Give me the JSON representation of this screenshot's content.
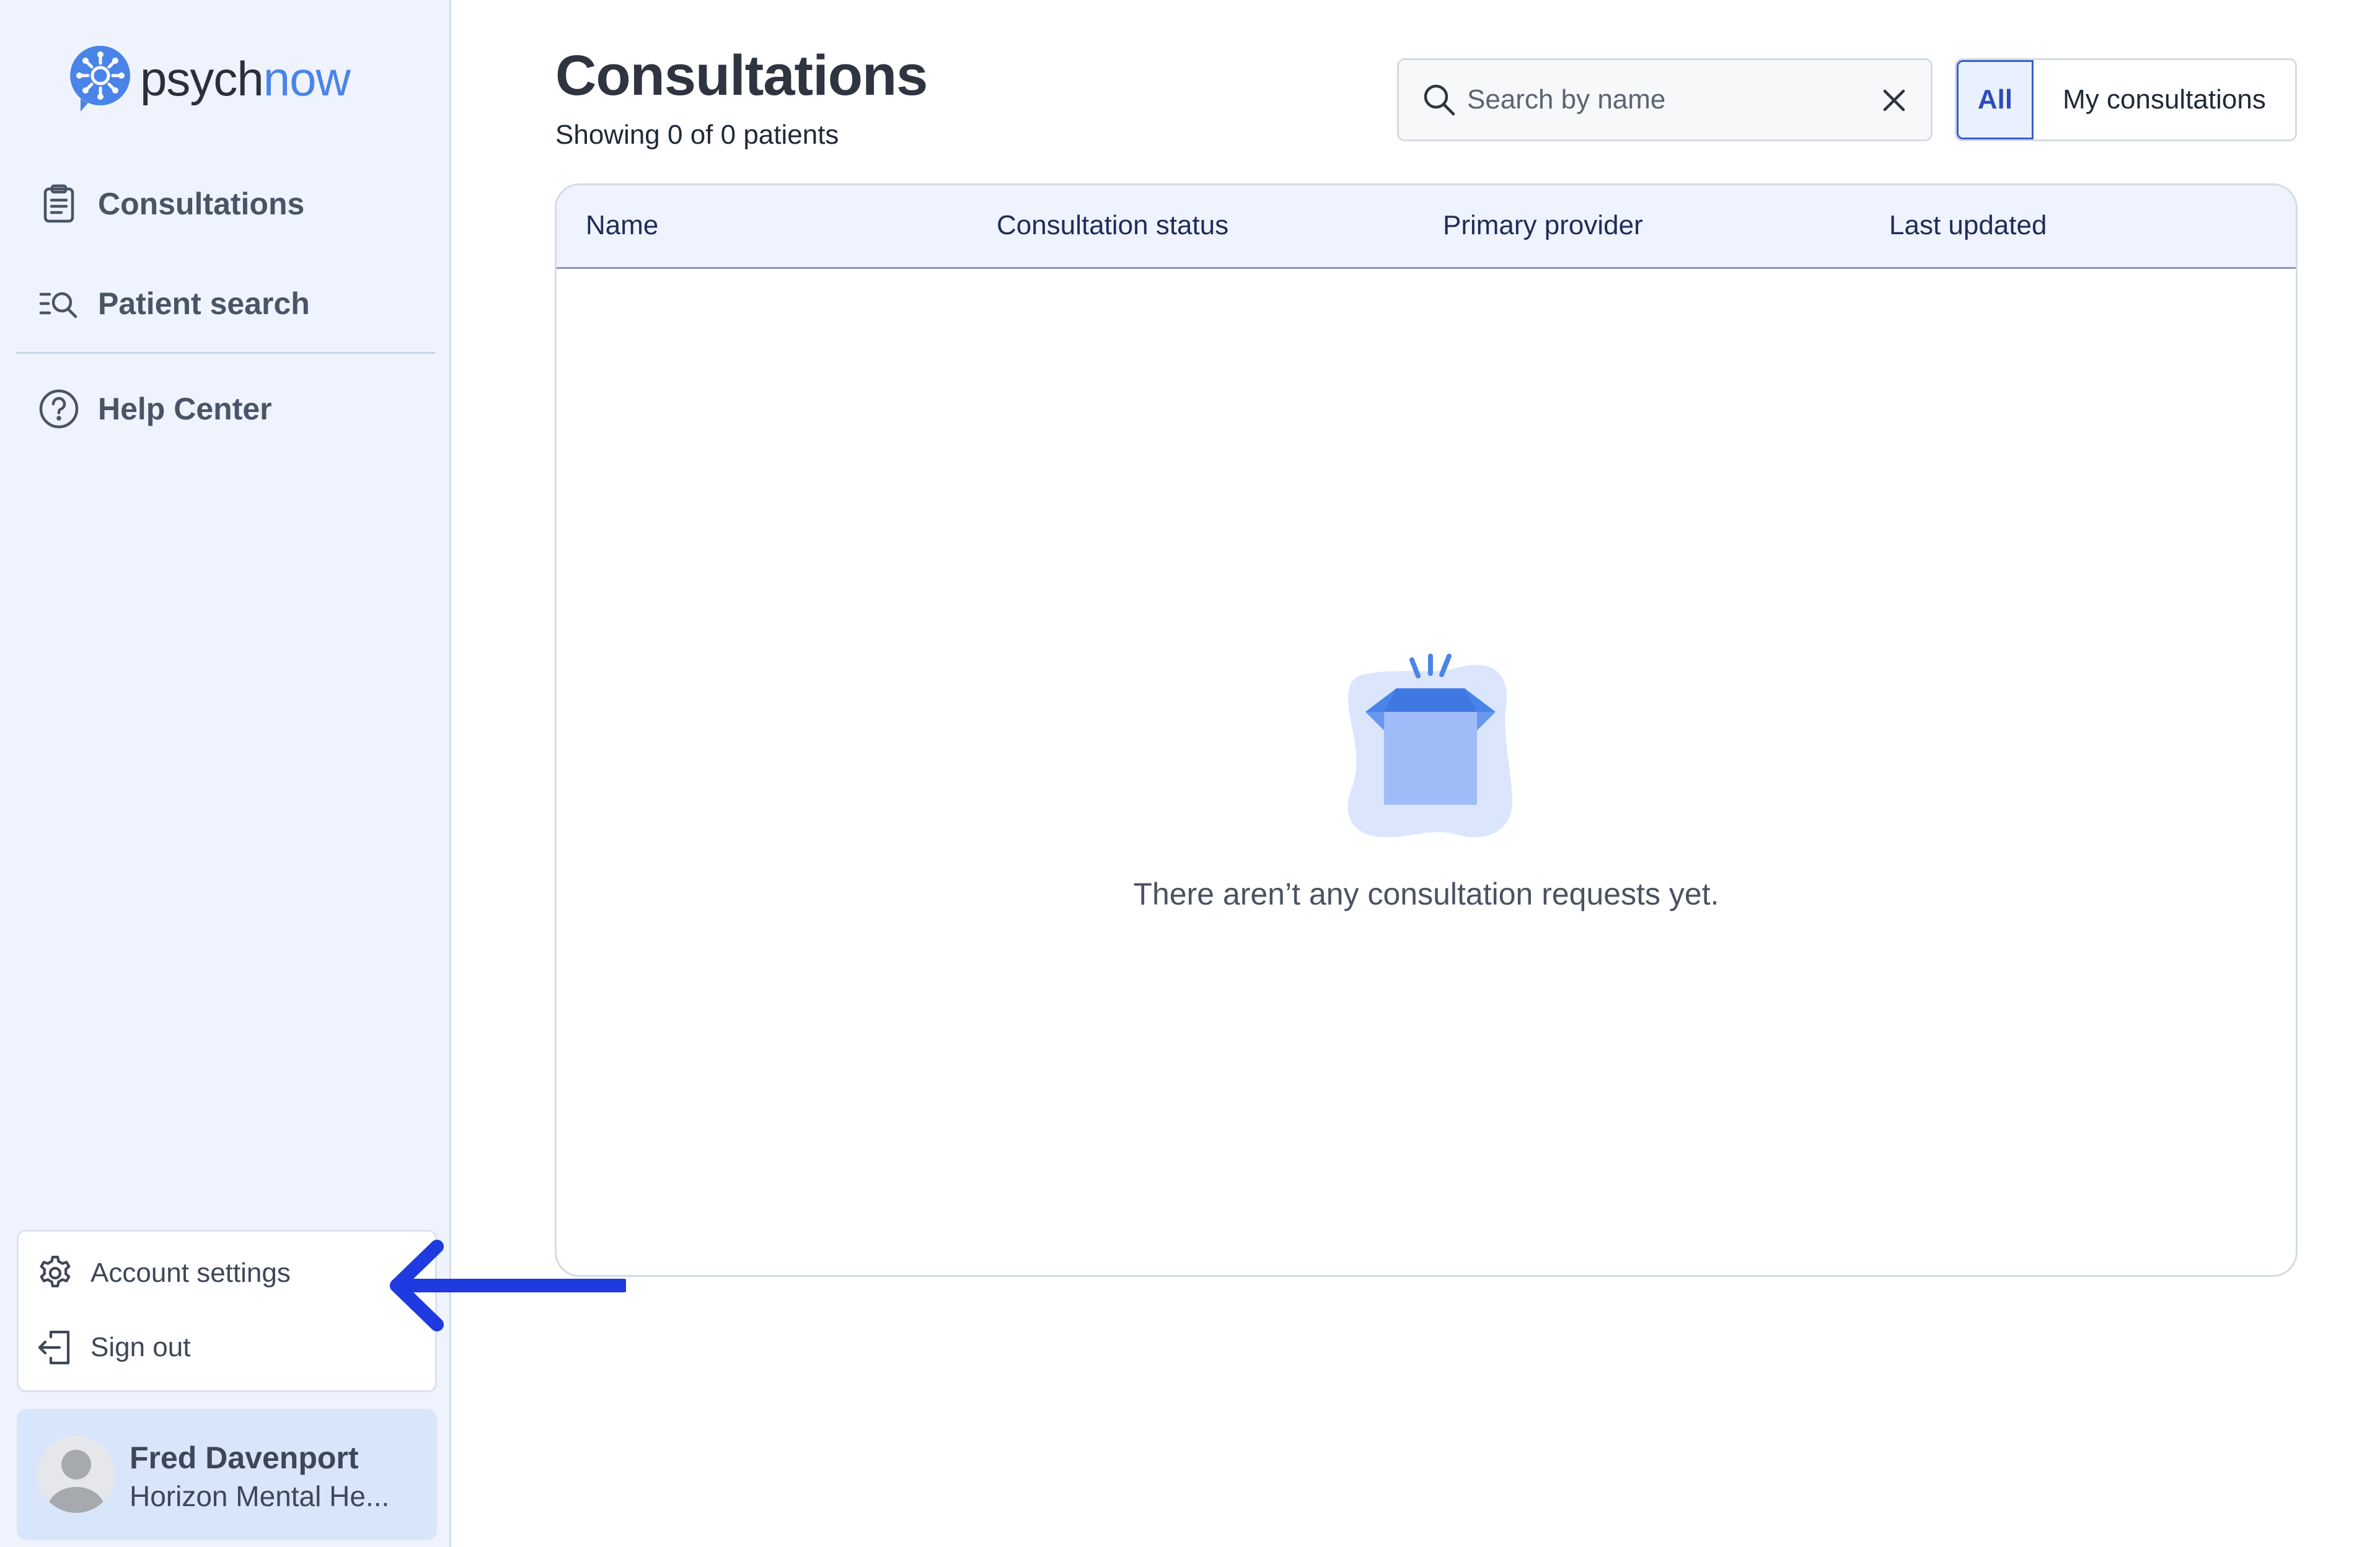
{
  "app": {
    "logo_part1": "psych",
    "logo_part2": "now"
  },
  "sidebar": {
    "nav": [
      {
        "label": "Consultations",
        "icon": "clipboard-icon"
      },
      {
        "label": "Patient search",
        "icon": "list-search-icon"
      },
      {
        "label": "Help Center",
        "icon": "help-circle-icon"
      }
    ],
    "menu": [
      {
        "label": "Account settings",
        "icon": "gear-icon"
      },
      {
        "label": "Sign out",
        "icon": "sign-out-icon"
      }
    ],
    "user": {
      "name": "Fred Davenport",
      "org": "Horizon Mental He..."
    }
  },
  "main": {
    "title": "Consultations",
    "subtitle": "Showing 0 of 0 patients",
    "search": {
      "placeholder": "Search by name",
      "value": ""
    },
    "filter": {
      "all_label": "All",
      "mine_label": "My consultations",
      "selected": "All"
    },
    "table": {
      "columns": [
        "Name",
        "Consultation status",
        "Primary provider",
        "Last updated"
      ],
      "rows": []
    },
    "empty_message": "There aren’t any consultation requests yet."
  },
  "colors": {
    "accent": "#4a84e8",
    "sidebar_bg": "#eef3fd",
    "annotation_arrow": "#1f3ae0"
  }
}
